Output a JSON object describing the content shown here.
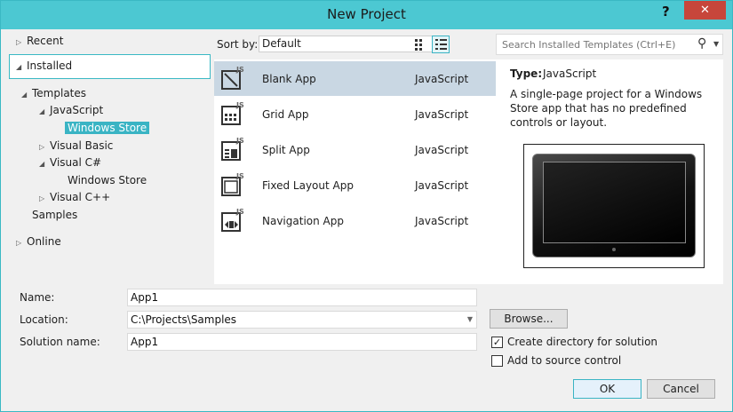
{
  "window": {
    "title": "New Project",
    "help": "?",
    "close": "✕"
  },
  "tree": {
    "recent": "Recent",
    "installed": "Installed",
    "templates": "Templates",
    "javascript": "JavaScript",
    "js_windows_store": "Windows Store",
    "visual_basic": "Visual Basic",
    "visual_csharp": "Visual C#",
    "cs_windows_store": "Windows Store",
    "visual_cpp": "Visual C++",
    "samples": "Samples",
    "online": "Online"
  },
  "sortbar": {
    "label": "Sort by:",
    "value": "Default"
  },
  "templates": [
    {
      "name": "Blank App",
      "lang": "JavaScript",
      "icon": "blank-app-icon"
    },
    {
      "name": "Grid App",
      "lang": "JavaScript",
      "icon": "grid-app-icon"
    },
    {
      "name": "Split App",
      "lang": "JavaScript",
      "icon": "split-app-icon"
    },
    {
      "name": "Fixed Layout App",
      "lang": "JavaScript",
      "icon": "fixed-layout-app-icon"
    },
    {
      "name": "Navigation App",
      "lang": "JavaScript",
      "icon": "navigation-app-icon"
    }
  ],
  "search": {
    "placeholder": "Search Installed Templates (Ctrl+E)"
  },
  "details": {
    "type_label": "Type:",
    "type_value": "JavaScript",
    "description": "A single-page project for a Windows Store app that has no predefined controls or layout."
  },
  "form": {
    "name_label": "Name:",
    "name_value": "App1",
    "location_label": "Location:",
    "location_value": "C:\\Projects\\Samples",
    "solution_label": "Solution name:",
    "solution_value": "App1",
    "browse": "Browse...",
    "create_dir_label": "Create directory for solution",
    "create_dir_checked": true,
    "source_control_label": "Add to source control",
    "source_control_checked": false
  },
  "buttons": {
    "ok": "OK",
    "cancel": "Cancel"
  },
  "colors": {
    "titlebar": "#4cc8d2",
    "accent": "#3ab4c4",
    "selection": "#c9d7e3",
    "close": "#c7463b"
  }
}
